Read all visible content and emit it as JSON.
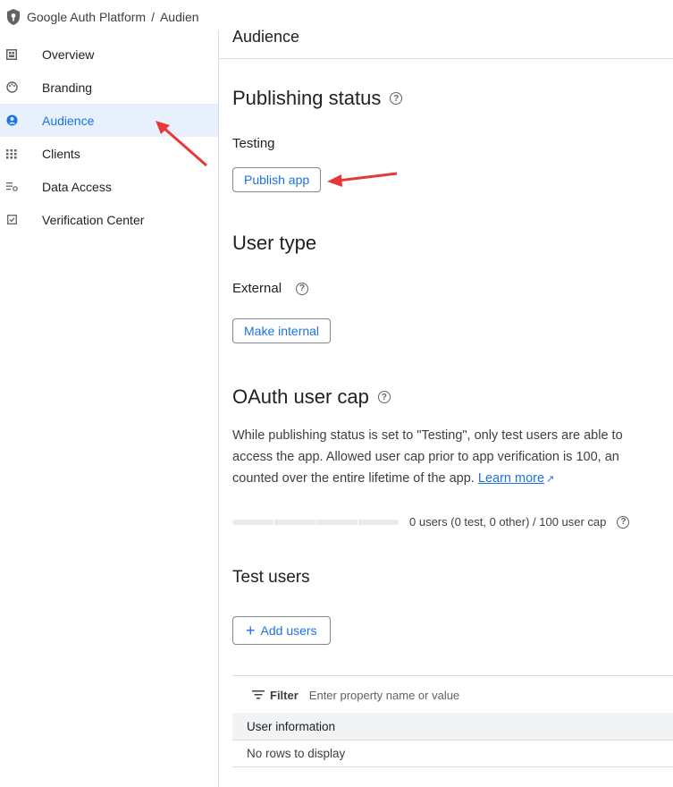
{
  "topbar": {
    "product": "Google Auth Platform",
    "separator": "/",
    "crumb": "Audien"
  },
  "sidebar": {
    "items": [
      {
        "label": "Overview",
        "icon": "dashboard-icon"
      },
      {
        "label": "Branding",
        "icon": "palette-icon"
      },
      {
        "label": "Audience",
        "icon": "person-icon",
        "active": true
      },
      {
        "label": "Clients",
        "icon": "grid-icon"
      },
      {
        "label": "Data Access",
        "icon": "settings-list-icon"
      },
      {
        "label": "Verification Center",
        "icon": "checkbox-icon"
      }
    ]
  },
  "main": {
    "page_title": "Audience",
    "publishing": {
      "heading": "Publishing status",
      "status": "Testing",
      "button": "Publish app"
    },
    "user_type": {
      "heading": "User type",
      "value": "External",
      "button": "Make internal"
    },
    "oauth": {
      "heading": "OAuth user cap",
      "line1": "While publishing status is set to \"Testing\", only test users are able to",
      "line2": "access the app. Allowed user cap prior to app verification is 100, an",
      "line3": "counted over the entire lifetime of the app.",
      "link": "Learn more",
      "cap_text": "0 users (0 test, 0 other) / 100 user cap",
      "cap_fraction": 0
    },
    "test_users": {
      "heading": "Test users",
      "add_button": "Add users",
      "filter_label": "Filter",
      "filter_placeholder": "Enter property name or value",
      "column": "User information",
      "empty": "No rows to display"
    }
  },
  "colors": {
    "accent": "#1a73e8",
    "active_bg": "#e8f0fe",
    "annotation": "#e53935"
  }
}
